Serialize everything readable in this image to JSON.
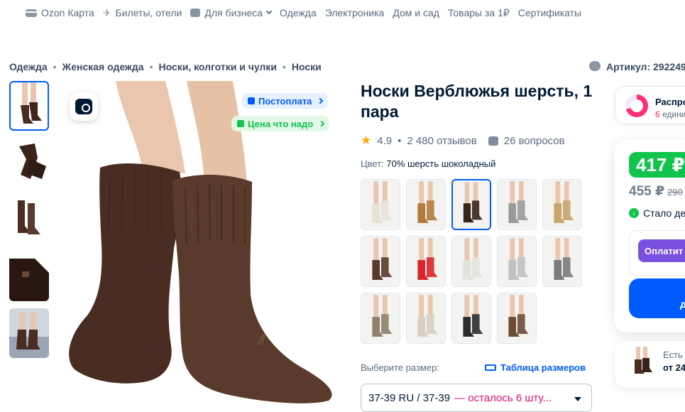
{
  "topnav": {
    "items": [
      "Ozon Карта",
      "Билеты, отели",
      "Для бизнеса",
      "Одежда",
      "Электроника",
      "Дом и сад",
      "Товары за 1₽",
      "Сертификаты"
    ]
  },
  "breadcrumbs": [
    "Одежда",
    "Женская одежда",
    "Носки, колготки и чулки",
    "Носки"
  ],
  "article": "Артикул: 292249",
  "badges": {
    "postpay": "Постоплата",
    "fair_price": "Цена что надо"
  },
  "product": {
    "title": "Носки Верблюжья шерсть, 1 пара",
    "rating": "4.9",
    "reviews": "2 480 отзывов",
    "questions": "26 вопросов",
    "color_label": "Цвет:",
    "color_value": "70% шерсть шоколадный"
  },
  "colors": {
    "brown": "#4a2d22",
    "skin": "#e9c6ad",
    "blue": "#005bff",
    "green": "#10c44c"
  },
  "swatches": [
    {
      "sock": "#e8e1d6"
    },
    {
      "sock": "#b27a3d"
    },
    {
      "sock": "#3a2319",
      "selected": true
    },
    {
      "sock": "#9a9a9a"
    },
    {
      "sock": "#c9a46b"
    },
    {
      "sock": "#5a3a2c"
    },
    {
      "sock": "#d8262a"
    },
    {
      "sock": "#e4e2dc"
    },
    {
      "sock": "#bfc0c2"
    },
    {
      "sock": "#7b7b7b"
    },
    {
      "sock": "#8f806c"
    },
    {
      "sock": "#d7d0c3"
    },
    {
      "sock": "#2b2b2b"
    },
    {
      "sock": "#6b4a36"
    }
  ],
  "size": {
    "label": "Выберите размер:",
    "table_link": "Таблица размеров",
    "selected": "37-39 RU / 37-39",
    "stock": "— осталось 6 шту..."
  },
  "sale": {
    "title": "Распро",
    "sub_count": "6",
    "sub_rest": " едини"
  },
  "price": {
    "current": "417 ₽",
    "old": "455 ₽",
    "crossed": "290",
    "cheaper": "Стало де",
    "pay_button": "Оплатит",
    "cart_button": "д"
  },
  "cheaper_card": {
    "line1": "Есть",
    "line2": "от 24"
  }
}
